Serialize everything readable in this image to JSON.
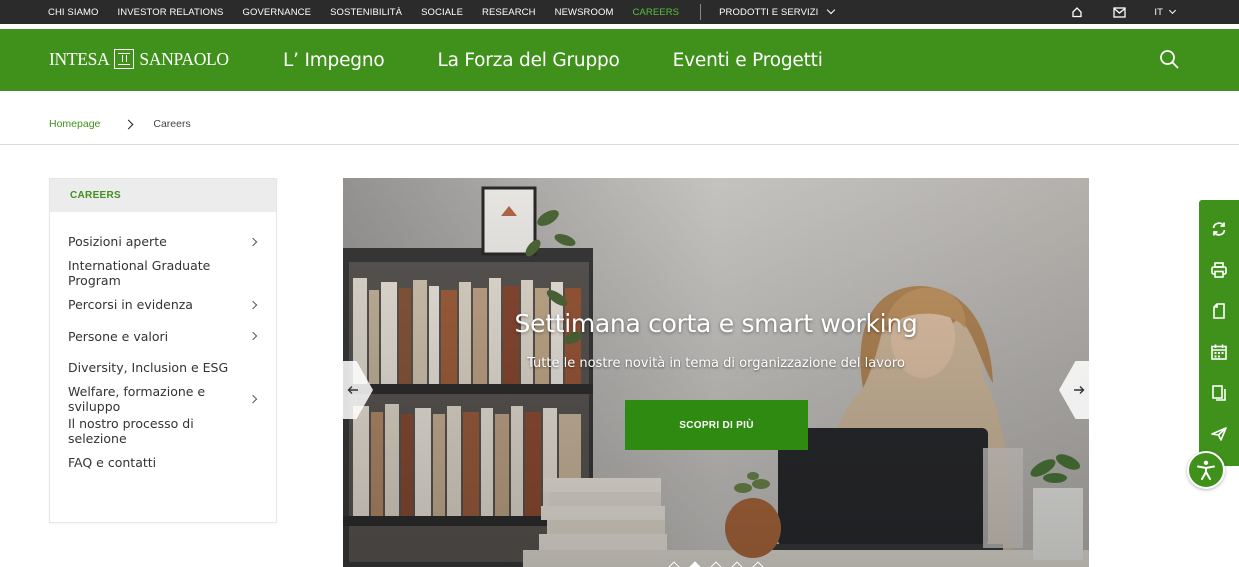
{
  "topbar": {
    "links": [
      {
        "label": "CHI SIAMO",
        "active": false
      },
      {
        "label": "INVESTOR RELATIONS",
        "active": false
      },
      {
        "label": "GOVERNANCE",
        "active": false
      },
      {
        "label": "SOSTENIBILITÀ",
        "active": false
      },
      {
        "label": "SOCIALE",
        "active": false
      },
      {
        "label": "RESEARCH",
        "active": false
      },
      {
        "label": "NEWSROOM",
        "active": false
      },
      {
        "label": "CAREERS",
        "active": true
      }
    ],
    "products_label": "PRODOTTI E SERVIZI",
    "icons": [
      "home-icon",
      "mail-icon"
    ],
    "language": "IT"
  },
  "brand": {
    "left": "INTESA",
    "right": "SANPAOLO"
  },
  "mainnav": {
    "items": [
      "L’ Impegno",
      "La Forza del Gruppo",
      "Eventi e Progetti"
    ],
    "search_icon": "search-icon"
  },
  "breadcrumb": {
    "home": "Homepage",
    "current": "Careers"
  },
  "sidebar": {
    "title": "CAREERS",
    "items": [
      {
        "label": "Posizioni aperte",
        "has_children": true
      },
      {
        "label": "International Graduate Program",
        "has_children": false
      },
      {
        "label": "Percorsi in evidenza",
        "has_children": true
      },
      {
        "label": "Persone e valori",
        "has_children": true
      },
      {
        "label": "Diversity, Inclusion e ESG",
        "has_children": false
      },
      {
        "label": "Welfare, formazione e sviluppo",
        "has_children": true
      },
      {
        "label": "Il nostro processo di selezione",
        "has_children": false
      },
      {
        "label": "FAQ e contatti",
        "has_children": false
      }
    ]
  },
  "hero": {
    "title": "Settimana corta e smart working",
    "subtitle": "Tutte le nostre novità in tema di organizzazione del lavoro",
    "cta": "SCOPRI DI PIÙ",
    "slides_count": 5,
    "active_slide": 1
  },
  "sidetools": [
    "refresh-icon",
    "print-icon",
    "document-icon",
    "calendar-icon",
    "copy-icon",
    "send-icon"
  ],
  "accessibility_icon": "accessibility-icon",
  "colors": {
    "brand_green": "#3f911b",
    "topbar_bg": "#2b2b2b",
    "active_link": "#55c23b",
    "cta_green": "#2f8a12"
  }
}
